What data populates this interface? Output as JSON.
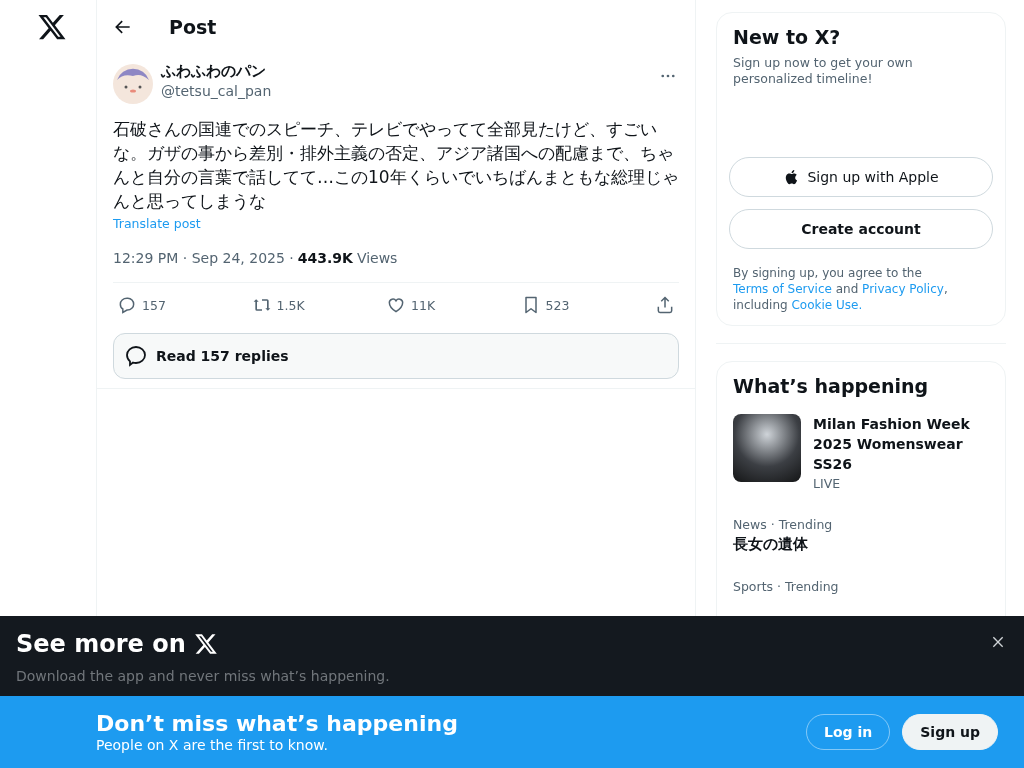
{
  "header": {
    "title": "Post"
  },
  "post": {
    "author_name": "ふわふわのパン",
    "handle": "@tetsu_cal_pan",
    "text": "石破さんの国連でのスピーチ、テレビでやってて全部見たけど、すごいな。ガザの事から差別・排外主義の否定、アジア諸国への配慮まで、ちゃんと自分の言葉で話してて…この10年くらいでいちばんまともな総理じゃんと思ってしまうな",
    "translate": "Translate post",
    "time": "12:29 PM · Sep 24, 2025 ·",
    "views_count": "443.9K",
    "views_label": "Views",
    "actions": [
      {
        "kind": "reply",
        "count": "157"
      },
      {
        "kind": "repost",
        "count": "1.5K"
      },
      {
        "kind": "like",
        "count": "11K"
      },
      {
        "kind": "bookmark",
        "count": "523"
      },
      {
        "kind": "share"
      }
    ],
    "read_replies": "Read 157 replies"
  },
  "signup_card": {
    "title": "New to X?",
    "subtitle": "Sign up now to get your own personalized timeline!",
    "buttons": [
      {
        "kind": "apple",
        "label": "Sign up with Apple"
      },
      {
        "kind": "plain",
        "label": "Create account"
      }
    ],
    "legal": [
      {
        "kind": "text",
        "text": "By signing up, you agree to the "
      },
      {
        "kind": "link",
        "text": "Terms of Service"
      },
      {
        "kind": "text",
        "text": " and "
      },
      {
        "kind": "link",
        "text": "Privacy Policy"
      },
      {
        "kind": "text",
        "text": ", including "
      },
      {
        "kind": "link",
        "text": "Cookie Use."
      }
    ]
  },
  "trends": {
    "title": "What’s happening",
    "items": [
      {
        "kind": "event",
        "title": "Milan Fashion Week 2025 Womenswear SS26",
        "status": "LIVE"
      },
      {
        "kind": "trend",
        "context": "News · Trending",
        "title": "長女の遺体"
      },
      {
        "kind": "trend",
        "context": "Sports · Trending"
      }
    ]
  },
  "app_banner": {
    "title": "See more on",
    "subtitle": "Download the app and never miss what’s happening."
  },
  "login_bar": {
    "title": "Don’t miss what’s happening",
    "subtitle": "People on X are the first to know.",
    "buttons": [
      {
        "kind": "outline",
        "label": "Log in"
      },
      {
        "kind": "solid",
        "label": "Sign up"
      }
    ]
  }
}
